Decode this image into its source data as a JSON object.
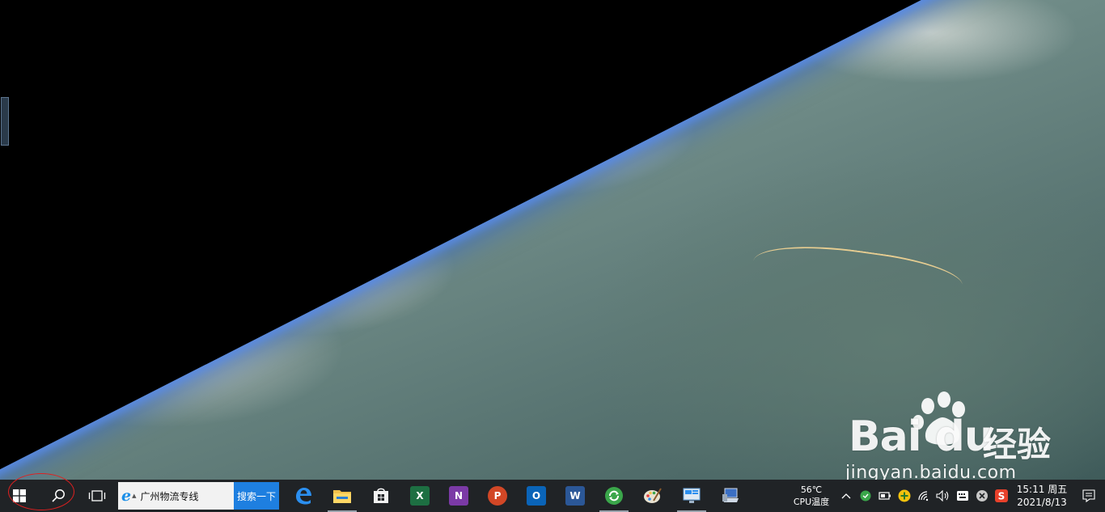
{
  "watermark": {
    "brand": "Bai du",
    "brand_cn": "经验",
    "url": "jingyan.baidu.com"
  },
  "taskbar": {
    "search": {
      "value": "广州物流专线",
      "button_label": "搜索一下"
    },
    "pinned": [
      {
        "name": "edge",
        "icon": "edge-icon"
      },
      {
        "name": "file-explorer",
        "icon": "folder-icon"
      },
      {
        "name": "store",
        "icon": "store-icon"
      },
      {
        "name": "excel",
        "icon": "excel-icon",
        "letter": "X",
        "color": "#1d6f42"
      },
      {
        "name": "onenote",
        "icon": "onenote-icon",
        "letter": "N",
        "color": "#7b3aa6"
      },
      {
        "name": "powerpoint",
        "icon": "powerpoint-icon",
        "letter": "P",
        "color": "#d24726"
      },
      {
        "name": "outlook",
        "icon": "outlook-icon",
        "letter": "O",
        "color": "#0a64b8"
      },
      {
        "name": "word",
        "icon": "word-icon",
        "letter": "W",
        "color": "#2b5797"
      },
      {
        "name": "green-app",
        "icon": "refresh-icon",
        "color": "#3aa64a"
      },
      {
        "name": "paint",
        "icon": "palette-icon"
      },
      {
        "name": "control-panel",
        "icon": "monitor-icon"
      },
      {
        "name": "network-app",
        "icon": "laptop-icon"
      }
    ],
    "cpu_temp": "56℃",
    "cpu_label": "CPU温度",
    "clock": {
      "time": "15:11",
      "weekday": "周五",
      "date": "2021/8/13"
    }
  }
}
